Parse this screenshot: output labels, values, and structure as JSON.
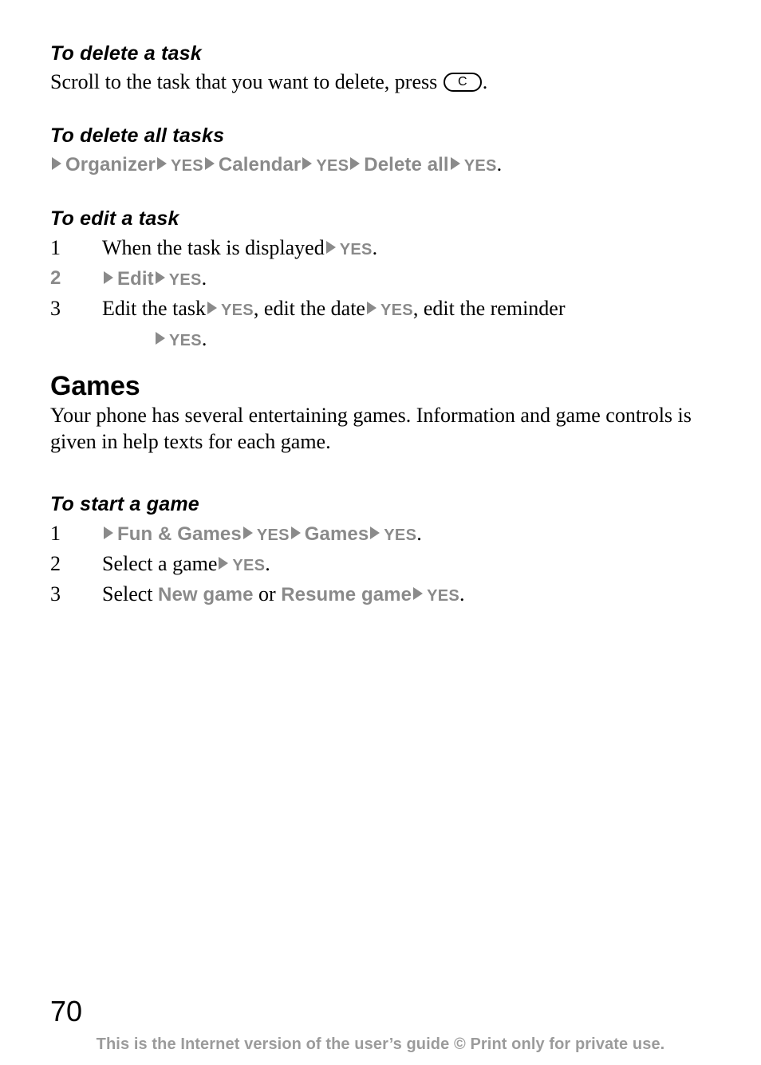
{
  "document": {
    "page_number": "70",
    "footer_note": "This is the Internet version of the user’s guide © Print only for private use.",
    "colors": {
      "text": "#000000",
      "menu_gray": "#8a8a8a",
      "footer_gray": "#9b9b9b",
      "background": "#ffffff"
    }
  },
  "sections": {
    "delete_task": {
      "heading": "To delete a task",
      "line_before_key": "Scroll to the task that you want to delete, press",
      "key_label": "C",
      "line_after_key": "."
    },
    "delete_all_tasks": {
      "heading": "To delete all tasks",
      "path": {
        "item1": "Organizer",
        "key1": "YES",
        "item2": "Calendar",
        "key2": "YES",
        "item3": "Delete all",
        "key3": "YES",
        "period": "."
      }
    },
    "edit_task": {
      "heading": "To edit a task",
      "steps": [
        {
          "number": "1",
          "number_style": "serif",
          "text_before": "When the task is displayed",
          "key": "YES",
          "period": "."
        },
        {
          "number": "2",
          "number_style": "sans-gray",
          "menu_item": "Edit",
          "key": "YES",
          "period": "."
        },
        {
          "number": "3",
          "number_style": "serif",
          "part1": "Edit the task",
          "key1": "YES",
          "part2": ", edit the date",
          "key2": "YES",
          "part3": ", edit the reminder",
          "key3": "YES",
          "period": "."
        }
      ]
    },
    "games": {
      "heading": "Games",
      "paragraph": "Your phone has several entertaining games. Information and game controls is given in help texts for each game."
    },
    "start_game": {
      "heading": "To start a game",
      "steps": [
        {
          "number": "1",
          "menu_item1": "Fun & Games",
          "key1": "YES",
          "menu_item2": "Games",
          "key2": "YES",
          "period": "."
        },
        {
          "number": "2",
          "text": "Select a game",
          "key": "YES",
          "period": "."
        },
        {
          "number": "3",
          "text_before": "Select",
          "option1": "New game",
          "conjunction": "or",
          "option2": "Resume game",
          "key": "YES",
          "period": "."
        }
      ]
    }
  }
}
